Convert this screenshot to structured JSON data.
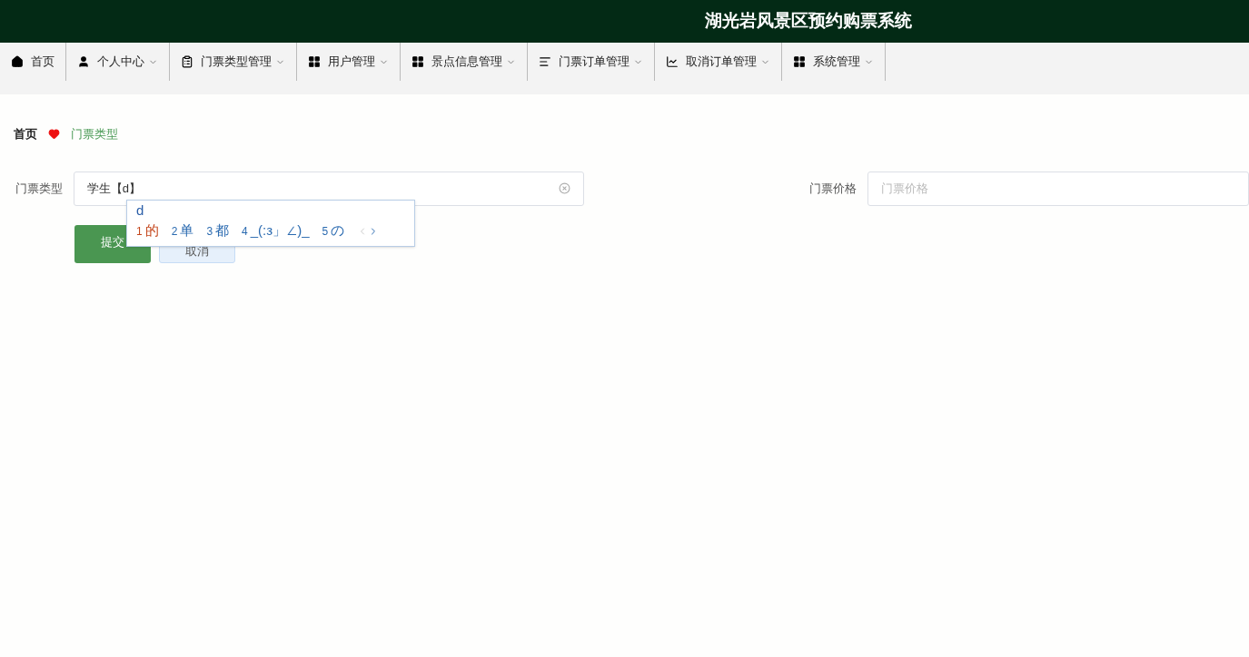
{
  "header": {
    "title": "湖光岩风景区预约购票系统"
  },
  "nav": [
    {
      "kind": "home",
      "label": "首页",
      "dropdown": false
    },
    {
      "kind": "user",
      "label": "个人中心",
      "dropdown": true
    },
    {
      "kind": "clipboard",
      "label": "门票类型管理",
      "dropdown": true
    },
    {
      "kind": "grid",
      "label": "用户管理",
      "dropdown": true
    },
    {
      "kind": "grid",
      "label": "景点信息管理",
      "dropdown": true
    },
    {
      "kind": "list",
      "label": "门票订单管理",
      "dropdown": true
    },
    {
      "kind": "chart",
      "label": "取消订单管理",
      "dropdown": true
    },
    {
      "kind": "grid",
      "label": "系统管理",
      "dropdown": true
    }
  ],
  "breadcrumb": {
    "home": "首页",
    "current": "门票类型"
  },
  "form": {
    "fields": [
      {
        "label": "门票类型",
        "value": "学生【d】",
        "clearable": true
      },
      {
        "label": "门票价格",
        "placeholder": "门票价格",
        "clearable": false
      }
    ],
    "buttons": [
      {
        "label": "提交",
        "kind": "primary"
      },
      {
        "label": "取消",
        "kind": "secondary"
      }
    ]
  },
  "ime": {
    "composition": "d",
    "candidates": [
      {
        "index": "1",
        "text": "的",
        "selected": true
      },
      {
        "index": "2",
        "text": "单",
        "selected": false
      },
      {
        "index": "3",
        "text": "都",
        "selected": false
      },
      {
        "index": "4",
        "text": "_(:з」∠)_",
        "selected": false
      },
      {
        "index": "5",
        "text": "の",
        "selected": false
      }
    ]
  }
}
